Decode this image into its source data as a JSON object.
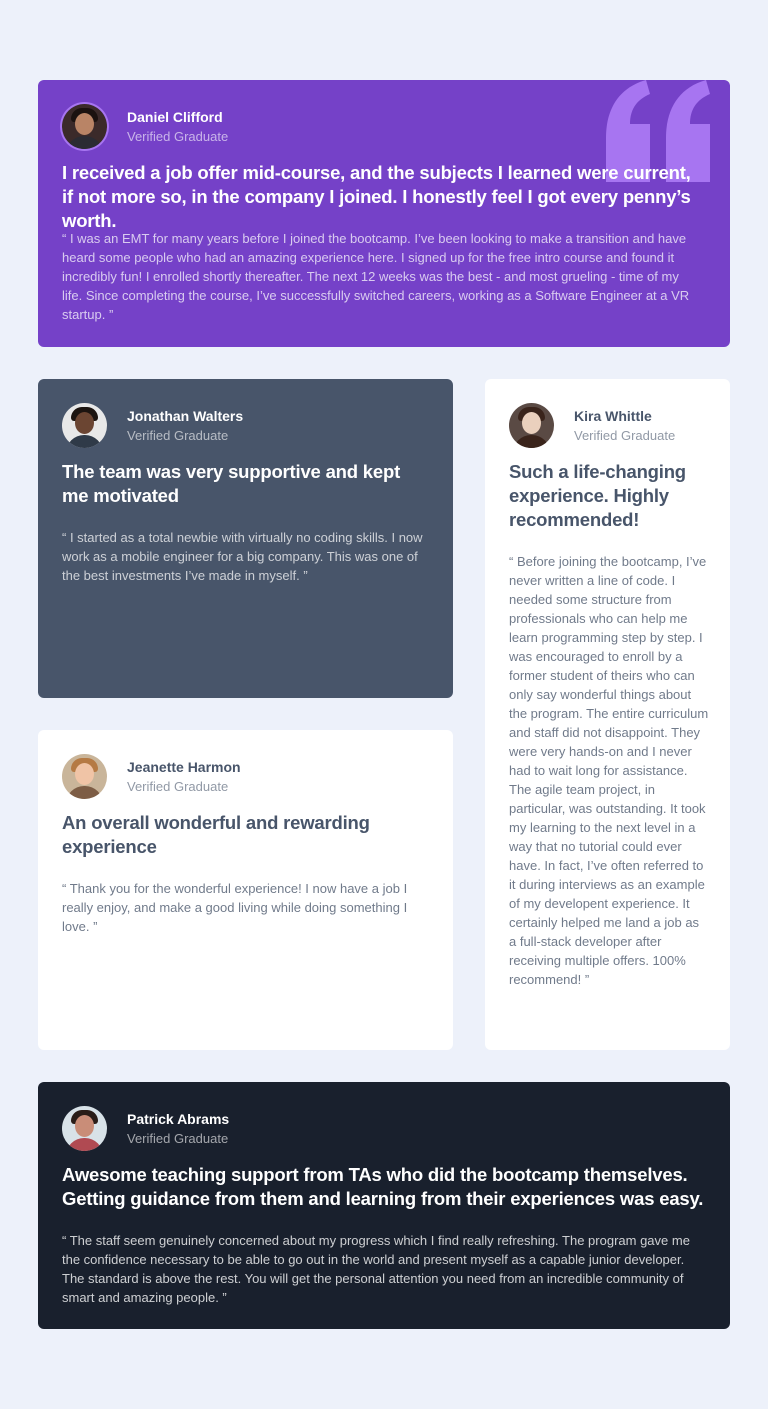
{
  "colors": {
    "background": "#edf1fa",
    "purple": "#7541c8",
    "slate": "#48556a",
    "white": "#ffffff",
    "dark": "#19202d",
    "quote_icon": "#a775f1"
  },
  "testimonials": [
    {
      "name": "Daniel Clifford",
      "role": "Verified Graduate",
      "headline": "I received a job offer mid-course, and the subjects I learned were current, if not more so, in the company I joined. I honestly feel I got every penny’s worth.",
      "body": "“ I was an EMT for many years before I joined the bootcamp. I’ve been looking to make a transition and have heard some people who had an amazing experience here. I signed up for the free intro course and found it incredibly fun! I enrolled shortly thereafter. The next 12 weeks was the best - and most grueling - time of my life. Since completing the course, I’ve successfully switched careers, working as a Software Engineer at a VR startup. ”",
      "icon": "quote-mark-icon"
    },
    {
      "name": "Jonathan Walters",
      "role": "Verified Graduate",
      "headline": "The team was very supportive and kept me motivated",
      "body": "“ I started as a total newbie with virtually no coding skills. I now work as a mobile engineer for a big company. This was one of the best investments I’ve made in myself. ”"
    },
    {
      "name": "Jeanette Harmon",
      "role": "Verified Graduate",
      "headline": "An overall wonderful and rewarding experience",
      "body": "“ Thank you for the wonderful experience! I now have a job I really enjoy, and make a good living while doing something I love. ”"
    },
    {
      "name": "Kira Whittle",
      "role": "Verified Graduate",
      "headline": "Such a life-changing experience. Highly recommended!",
      "body": "“ Before joining the bootcamp, I’ve never written a line of code. I needed some structure from professionals who can help me learn programming step by step. I was encouraged to enroll by a former student of theirs who can only say wonderful things about the program. The entire curriculum and staff did not disappoint. They were very hands-on and I never had to wait long for assistance. The agile team project, in particular, was outstanding. It took my learning to the next level in a way that no tutorial could ever have. In fact, I’ve often referred to it during interviews as an example of my developent experience. It certainly helped me land a job as a full-stack developer after receiving multiple offers. 100% recommend! ”"
    },
    {
      "name": "Patrick Abrams",
      "role": "Verified Graduate",
      "headline": "Awesome teaching support from TAs who did the bootcamp themselves. Getting guidance from them and learning from their experiences was easy.",
      "body": "“ The staff seem genuinely concerned about my progress which I find really refreshing. The program gave me the confidence necessary to be able to go out in the world and present myself as a capable junior developer. The standard is above the rest. You will get the personal attention you need from an incredible community of smart and amazing people. ”"
    }
  ]
}
